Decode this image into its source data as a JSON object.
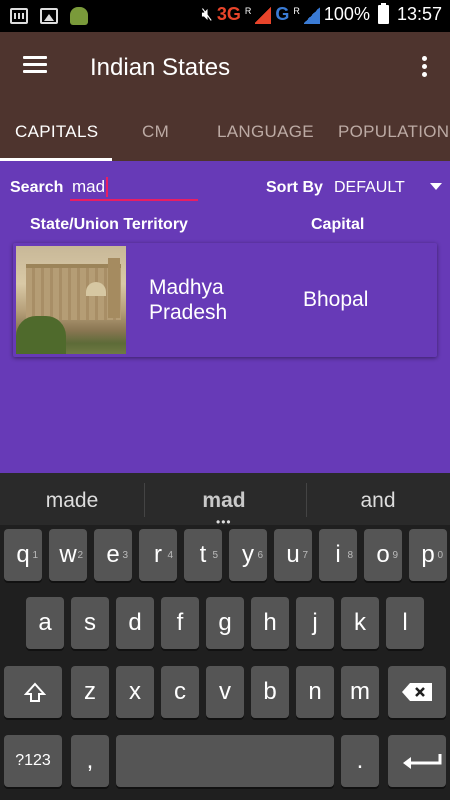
{
  "status_bar": {
    "network_1": "3G",
    "network_2": "G",
    "roaming_1": "R",
    "roaming_2": "R",
    "battery": "100%",
    "time": "13:57"
  },
  "app_bar": {
    "title": "Indian States"
  },
  "tabs": [
    {
      "label": "CAPITALS",
      "active": true
    },
    {
      "label": "CM"
    },
    {
      "label": "LANGUAGE"
    },
    {
      "label": "POPULATION"
    }
  ],
  "search": {
    "label": "Search",
    "value": "mad"
  },
  "sort": {
    "label": "Sort By",
    "value": "DEFAULT"
  },
  "columns": {
    "state": "State/Union Territory",
    "capital": "Capital"
  },
  "results": [
    {
      "state": "Madhya Pradesh",
      "capital": "Bhopal"
    }
  ],
  "keyboard": {
    "suggestions": [
      "made",
      "mad",
      "and"
    ],
    "row1": [
      {
        "k": "q",
        "h": "1"
      },
      {
        "k": "w",
        "h": "2"
      },
      {
        "k": "e",
        "h": "3"
      },
      {
        "k": "r",
        "h": "4"
      },
      {
        "k": "t",
        "h": "5"
      },
      {
        "k": "y",
        "h": "6"
      },
      {
        "k": "u",
        "h": "7"
      },
      {
        "k": "i",
        "h": "8"
      },
      {
        "k": "o",
        "h": "9"
      },
      {
        "k": "p",
        "h": "0"
      }
    ],
    "row2": [
      "a",
      "s",
      "d",
      "f",
      "g",
      "h",
      "j",
      "k",
      "l"
    ],
    "row3": [
      "z",
      "x",
      "c",
      "v",
      "b",
      "n",
      "m"
    ],
    "symbols": "?123",
    "comma": ",",
    "period": "."
  }
}
